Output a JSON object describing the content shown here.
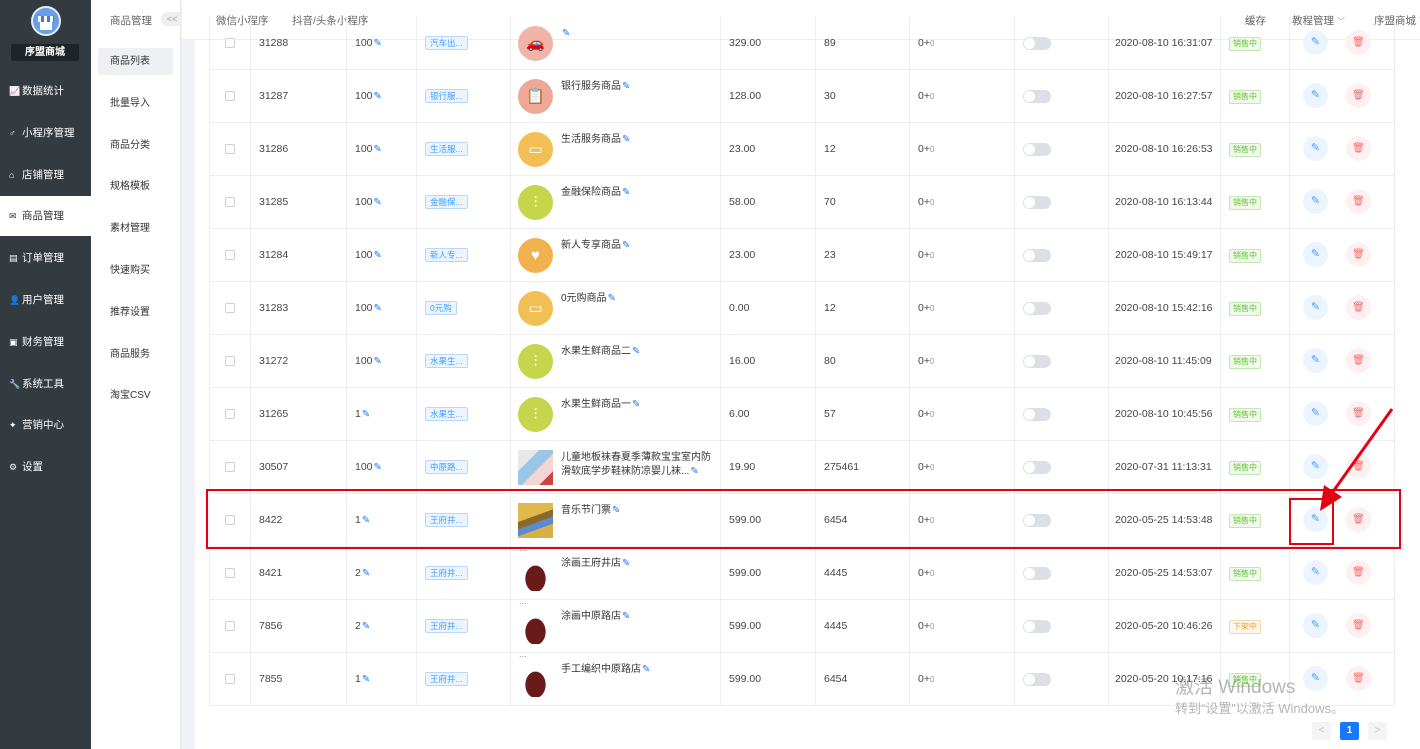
{
  "brand": {
    "name": "序盟商城"
  },
  "main_menu": [
    {
      "label": "数据统计",
      "icon": "chart-icon"
    },
    {
      "label": "小程序管理",
      "icon": "link-icon"
    },
    {
      "label": "店铺管理",
      "icon": "store-icon"
    },
    {
      "label": "商品管理",
      "icon": "goods-icon",
      "active": true
    },
    {
      "label": "订单管理",
      "icon": "order-icon"
    },
    {
      "label": "用户管理",
      "icon": "user-icon"
    },
    {
      "label": "财务管理",
      "icon": "wallet-icon"
    },
    {
      "label": "系统工具",
      "icon": "wrench-icon"
    },
    {
      "label": "营销中心",
      "icon": "marketing-icon"
    },
    {
      "label": "设置",
      "icon": "settings-icon"
    }
  ],
  "sub_menu": {
    "title": "商品管理",
    "collapse": "<<",
    "items": [
      {
        "label": "商品列表",
        "active": true
      },
      {
        "label": "批量导入"
      },
      {
        "label": "商品分类"
      },
      {
        "label": "规格模板"
      },
      {
        "label": "素材管理"
      },
      {
        "label": "快速购买"
      },
      {
        "label": "推荐设置"
      },
      {
        "label": "商品服务"
      },
      {
        "label": "淘宝CSV"
      }
    ]
  },
  "topnav": {
    "wechat": "微信小程序",
    "douyin": "抖音/头条小程序",
    "cache": "缓存",
    "tutorial": "教程管理",
    "store": "序盟商城"
  },
  "products": [
    {
      "id": "31288",
      "sort": "100",
      "category": "汽车出...",
      "name": "",
      "price": "329.00",
      "sales": "89",
      "stock": "0+",
      "stock_sub": "0",
      "date": "2020-08-10 16:31:07",
      "status": "销售中",
      "status_type": "on",
      "thumb": "car"
    },
    {
      "id": "31287",
      "sort": "100",
      "category": "银行服...",
      "name": "银行服务商品",
      "price": "128.00",
      "sales": "30",
      "stock": "0+",
      "stock_sub": "0",
      "date": "2020-08-10 16:27:57",
      "status": "销售中",
      "status_type": "on",
      "thumb": "bank"
    },
    {
      "id": "31286",
      "sort": "100",
      "category": "生活服...",
      "name": "生活服务商品",
      "price": "23.00",
      "sales": "12",
      "stock": "0+",
      "stock_sub": "0",
      "date": "2020-08-10 16:26:53",
      "status": "销售中",
      "status_type": "on",
      "thumb": "life"
    },
    {
      "id": "31285",
      "sort": "100",
      "category": "金融保...",
      "name": "金融保险商品",
      "price": "58.00",
      "sales": "70",
      "stock": "0+",
      "stock_sub": "0",
      "date": "2020-08-10 16:13:44",
      "status": "销售中",
      "status_type": "on",
      "thumb": "wheat"
    },
    {
      "id": "31284",
      "sort": "100",
      "category": "新人专...",
      "name": "新人专享商品",
      "price": "23.00",
      "sales": "23",
      "stock": "0+",
      "stock_sub": "0",
      "date": "2020-08-10 15:49:17",
      "status": "销售中",
      "status_type": "on",
      "thumb": "heart"
    },
    {
      "id": "31283",
      "sort": "100",
      "category": "0元购",
      "name": "0元购商品",
      "price": "0.00",
      "sales": "12",
      "stock": "0+",
      "stock_sub": "0",
      "date": "2020-08-10 15:42:16",
      "status": "销售中",
      "status_type": "on",
      "thumb": "life"
    },
    {
      "id": "31272",
      "sort": "100",
      "category": "水果生...",
      "name": "水果生鲜商品二",
      "price": "16.00",
      "sales": "80",
      "stock": "0+",
      "stock_sub": "0",
      "date": "2020-08-10 11:45:09",
      "status": "销售中",
      "status_type": "on",
      "thumb": "wheat"
    },
    {
      "id": "31265",
      "sort": "1",
      "category": "水果生...",
      "name": "水果生鲜商品一",
      "price": "6.00",
      "sales": "57",
      "stock": "0+",
      "stock_sub": "0",
      "date": "2020-08-10 10:45:56",
      "status": "销售中",
      "status_type": "on",
      "thumb": "wheat"
    },
    {
      "id": "30507",
      "sort": "100",
      "category": "中原路...",
      "name": "儿童地板袜春夏季薄款宝宝室内防滑软底学步鞋袜防凉婴儿袜...",
      "price": "19.90",
      "sales": "275461",
      "stock": "0+",
      "stock_sub": "0",
      "date": "2020-07-31 11:13:31",
      "status": "销售中",
      "status_type": "on",
      "thumb": "socks"
    },
    {
      "id": "8422",
      "sort": "1",
      "category": "王府井...",
      "name": "音乐节门票",
      "price": "599.00",
      "sales": "6454",
      "stock": "0+",
      "stock_sub": "0",
      "date": "2020-05-25 14:53:48",
      "status": "销售中",
      "status_type": "on",
      "thumb": "ticket"
    },
    {
      "id": "8421",
      "sort": "2",
      "category": "王府井...",
      "name": "涂画王府井店",
      "price": "599.00",
      "sales": "4445",
      "stock": "0+",
      "stock_sub": "0",
      "date": "2020-05-25 14:53:07",
      "status": "销售中",
      "status_type": "on",
      "thumb": "bag"
    },
    {
      "id": "7856",
      "sort": "2",
      "category": "王府井...",
      "name": "涂画中原路店",
      "price": "599.00",
      "sales": "4445",
      "stock": "0+",
      "stock_sub": "0",
      "date": "2020-05-20 10:46:26",
      "status": "下架中",
      "status_type": "off",
      "thumb": "bag"
    },
    {
      "id": "7855",
      "sort": "1",
      "category": "王府井...",
      "name": "手工编织中原路店",
      "price": "599.00",
      "sales": "6454",
      "stock": "0+",
      "stock_sub": "0",
      "date": "2020-05-20 10:17:16",
      "status": "销售中",
      "status_type": "on",
      "thumb": "bag"
    }
  ],
  "pagination": {
    "prev": "<",
    "current": "1",
    "next": ">"
  },
  "watermark": {
    "line1": "激活 Windows",
    "line2": "转到“设置”以激活 Windows。"
  },
  "colors": {
    "sidebar": "#333a40",
    "accent": "#1677ff",
    "highlight": "#e60012",
    "on": "#67c23a",
    "off": "#e6a23c"
  }
}
